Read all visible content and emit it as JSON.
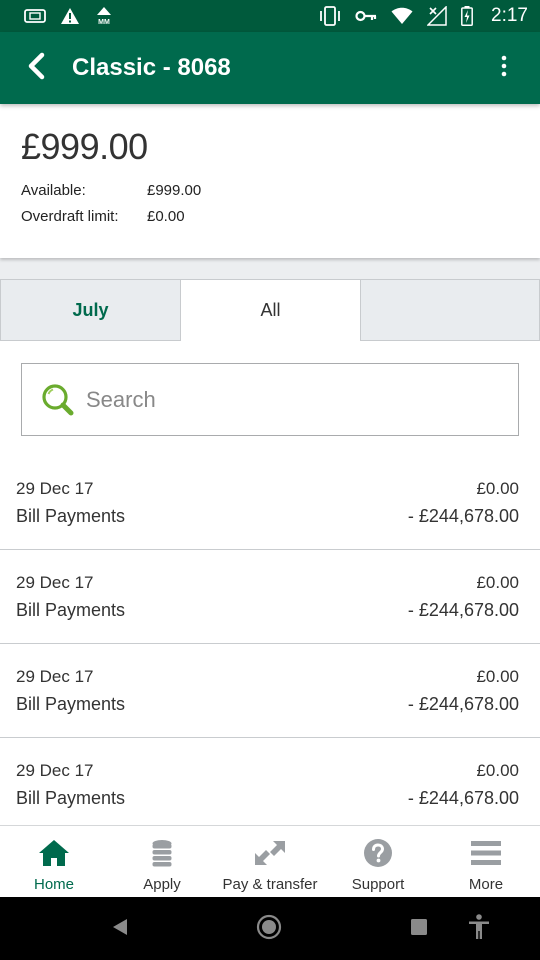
{
  "status_bar": {
    "time": "2:17",
    "left_icons": [
      "sim-card-icon",
      "warning-icon",
      "mm-icon"
    ],
    "right_icons": [
      "vibrate-icon",
      "vpn-key-icon",
      "wifi-icon",
      "no-signal-icon",
      "battery-charging-icon"
    ],
    "mm_text": "MM"
  },
  "app_bar": {
    "title": "Classic - 8068",
    "back_icon": "chevron-left-icon",
    "menu_icon": "more-vert-icon"
  },
  "balance": {
    "amount": "£999.00",
    "available_label": "Available:",
    "available_value": "£999.00",
    "overdraft_label": "Overdraft limit:",
    "overdraft_value": "£0.00"
  },
  "tabs": [
    {
      "label": "July",
      "active": false
    },
    {
      "label": "All",
      "active": true
    },
    {
      "label": ""
    }
  ],
  "search": {
    "placeholder": "Search",
    "value": ""
  },
  "transactions": [
    {
      "date": "29 Dec 17",
      "description": "Bill Payments",
      "amount_top": "£0.00",
      "amount_bottom": "- £244,678.00"
    },
    {
      "date": "29 Dec 17",
      "description": "Bill Payments",
      "amount_top": "£0.00",
      "amount_bottom": "- £244,678.00"
    },
    {
      "date": "29 Dec 17",
      "description": "Bill Payments",
      "amount_top": "£0.00",
      "amount_bottom": "- £244,678.00"
    },
    {
      "date": "29 Dec 17",
      "description": "Bill Payments",
      "amount_top": "£0.00",
      "amount_bottom": "- £244,678.00"
    }
  ],
  "bottom_nav": [
    {
      "label": "Home",
      "icon": "home-icon",
      "active": true
    },
    {
      "label": "Apply",
      "icon": "coins-stack-icon",
      "active": false
    },
    {
      "label": "Pay & transfer",
      "icon": "transfer-arrows-icon",
      "active": false
    },
    {
      "label": "Support",
      "icon": "help-circle-icon",
      "active": false
    },
    {
      "label": "More",
      "icon": "hamburger-menu-icon",
      "active": false
    }
  ],
  "colors": {
    "brand_green": "#006a4d",
    "status_green": "#005a3c",
    "search_icon_green": "#7ab800"
  }
}
